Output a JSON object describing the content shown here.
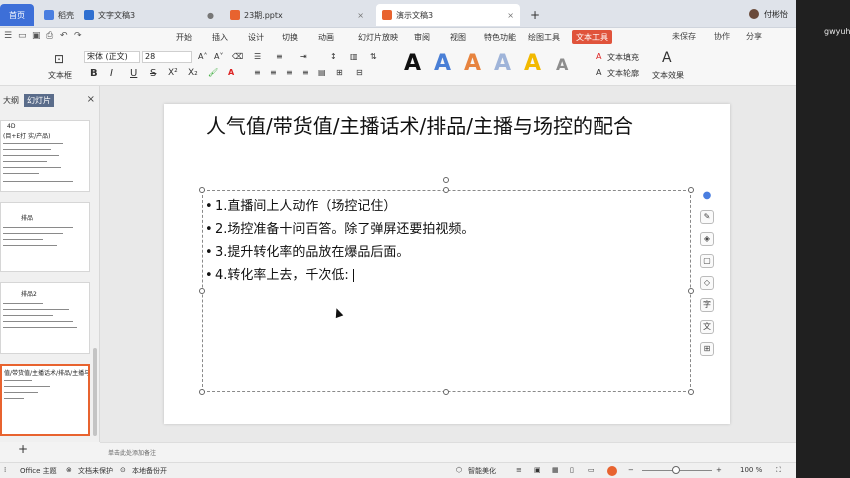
{
  "window": {
    "tabs": [
      {
        "label": "首页"
      },
      {
        "label": "稻壳"
      },
      {
        "label": "文字文稿3"
      },
      {
        "label": "23期.pptx"
      },
      {
        "label": "演示文稿3"
      }
    ],
    "new_tab": "+",
    "user_name": "付彬怡",
    "external_user": "gwyuh"
  },
  "menu": {
    "items": [
      "开始",
      "插入",
      "设计",
      "切换",
      "动画",
      "幻灯片放映",
      "审阅",
      "视图",
      "特色功能",
      "绘图工具",
      "文本工具"
    ],
    "right_actions": [
      "未保存",
      "协作",
      "分享"
    ]
  },
  "ribbon": {
    "text_box_label": "文本框",
    "font_name": "宋体 (正文)",
    "font_size": "28",
    "format_buttons": [
      "B",
      "I",
      "U",
      "S",
      "X²",
      "X₂"
    ],
    "text_fill": "文本填充",
    "text_outline": "文本轮廓",
    "text_effect": "文本效果",
    "wordart_colors": [
      "#111111",
      "#4a7fd6",
      "#e7843f",
      "#9fb4d9",
      "#f2b900",
      "#8d8d8d"
    ]
  },
  "left_panel": {
    "tabs": [
      "大纲",
      "幻灯片"
    ],
    "close": "×",
    "add": "+",
    "thumbs": [
      {
        "title": "4D",
        "sub": "(目+E打 实/产品)"
      },
      {
        "title": "排品"
      },
      {
        "title": "排品2"
      },
      {
        "title": "值/带货值/主播话术/排品/主播与场控的"
      }
    ]
  },
  "slide": {
    "title": "人气值/带货值/主播话术/排品/主播与场控的配合",
    "bullets": [
      "1.直播间上人动作（场控记住）",
      "2.场控准备十问百答。除了弹屏还要拍视频。",
      "3.提升转化率的品放在爆品后面。",
      "4.转化率上去，千次低:"
    ]
  },
  "notes": {
    "placeholder": "单击此处添加备注"
  },
  "status": {
    "theme": "Office 主题",
    "protection": "文档未保护",
    "backup": "本地备份开",
    "beautify": "智能美化",
    "zoom": "100 %"
  }
}
